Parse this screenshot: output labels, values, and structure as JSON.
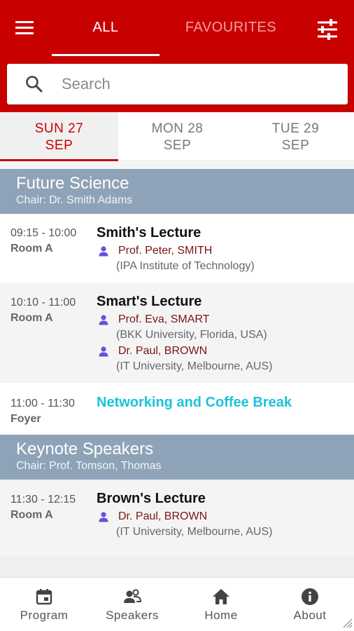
{
  "header": {
    "tabs": [
      {
        "label": "ALL",
        "active": true
      },
      {
        "label": "FAVOURITES",
        "active": false
      }
    ],
    "menu_icon": "hamburger-menu-icon",
    "filter_icon": "sliders-filter-icon",
    "color": "#c90000"
  },
  "search": {
    "placeholder": "Search",
    "value": "",
    "icon": "search-icon"
  },
  "days": [
    {
      "day": "SUN 27",
      "month": "SEP",
      "active": true
    },
    {
      "day": "MON 28",
      "month": "SEP",
      "active": false
    },
    {
      "day": "TUE 29",
      "month": "SEP",
      "active": false
    }
  ],
  "sessions": [
    {
      "title": "Future Science",
      "chair": "Chair: Dr. Smith Adams",
      "items": [
        {
          "time": "09:15 - 10:00",
          "room": "Room A",
          "title": "Smith's Lecture",
          "speakers": [
            {
              "name": "Prof. Peter, SMITH",
              "affiliation": "(IPA Institute of Technology)"
            }
          ]
        },
        {
          "time": "10:10 - 11:00",
          "room": "Room A",
          "title": "Smart's Lecture",
          "speakers": [
            {
              "name": "Prof. Eva, SMART",
              "affiliation": "(BKK University, Florida, USA)"
            },
            {
              "name": "Dr. Paul, BROWN",
              "affiliation": "(IT University, Melbourne, AUS)"
            }
          ]
        },
        {
          "time": "11:00 - 11:30",
          "room": "Foyer",
          "title": "Networking and Coffee Break",
          "speakers": []
        }
      ]
    },
    {
      "title": "Keynote Speakers",
      "chair": "Chair: Prof. Tomson, Thomas",
      "items": [
        {
          "time": "11:30 - 12:15",
          "room": "Room A",
          "title": "Brown's Lecture",
          "speakers": [
            {
              "name": "Dr. Paul, BROWN",
              "affiliation": "(IT University, Melbourne, AUS)"
            }
          ]
        }
      ]
    }
  ],
  "bottom_nav": [
    {
      "label": "Program",
      "icon": "calendar-icon"
    },
    {
      "label": "Speakers",
      "icon": "speakers-icon"
    },
    {
      "label": "Home",
      "icon": "home-icon"
    },
    {
      "label": "About",
      "icon": "info-icon"
    }
  ],
  "colors": {
    "primary": "#c90000",
    "section_header": "#8fa3b8",
    "break_title": "#1dc3da",
    "speaker_icon": "#6a4de0"
  }
}
